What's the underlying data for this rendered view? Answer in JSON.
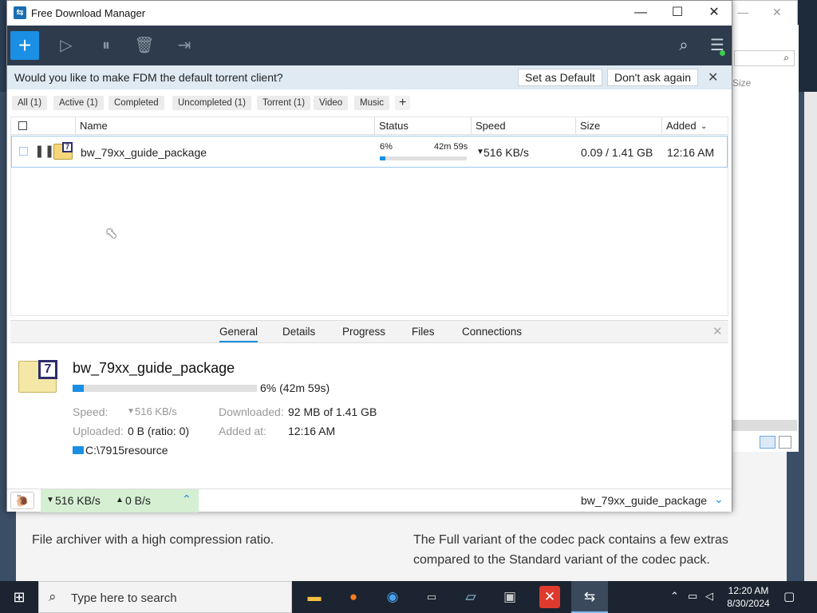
{
  "app": {
    "title": "Free Download Manager"
  },
  "banner": {
    "message": "Would you like to make FDM the default torrent client?",
    "set_default": "Set as Default",
    "dont_ask": "Don't ask again"
  },
  "filters": [
    {
      "label": "All (1)"
    },
    {
      "label": "Active (1)"
    },
    {
      "label": "Completed"
    },
    {
      "label": "Uncompleted (1)"
    },
    {
      "label": "Torrent (1)"
    },
    {
      "label": "Video"
    },
    {
      "label": "Music"
    }
  ],
  "columns": {
    "name": "Name",
    "status": "Status",
    "speed": "Speed",
    "size": "Size",
    "added": "Added"
  },
  "download": {
    "name": "bw_79xx_guide_package",
    "percent": "6%",
    "progress": 0.06,
    "eta": "42m 59s",
    "speed": "516 KB/s",
    "size": "0.09 / 1.41 GB",
    "added": "12:16 AM"
  },
  "details": {
    "tabs": [
      "General",
      "Details",
      "Progress",
      "Files",
      "Connections"
    ],
    "name": "bw_79xx_guide_package",
    "progress_text": "6% (42m 59s)",
    "speed_label": "Speed:",
    "speed_value": "516 KB/s",
    "downloaded_label": "Downloaded:",
    "downloaded_value": "92 MB of 1.41 GB",
    "uploaded_label": "Uploaded:",
    "uploaded_value": "0 B (ratio: 0)",
    "added_label": "Added at:",
    "added_value": "12:16 AM",
    "path": "C:\\7915resource"
  },
  "statusbar": {
    "down_speed": "516 KB/s",
    "up_speed": "0 B/s",
    "current": "bw_79xx_guide_package"
  },
  "background": {
    "text_left": "File archiver with a high compression ratio.",
    "text_right_1": "The Full variant of the codec pack contains a few extras",
    "text_right_2": "compared to the Standard variant of the codec pack.",
    "explorer_col": "Size"
  },
  "taskbar": {
    "search_placeholder": "Type here to search",
    "time": "12:20 AM",
    "date": "8/30/2024"
  }
}
